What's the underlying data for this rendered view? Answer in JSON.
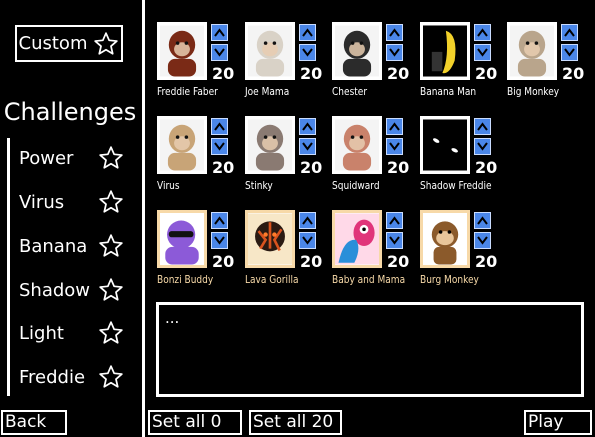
{
  "left_panel": {
    "custom_label": "Custom",
    "challenges_title": "Challenges",
    "challenges": [
      {
        "label": "Power"
      },
      {
        "label": "Virus"
      },
      {
        "label": "Banana"
      },
      {
        "label": "Shadow"
      },
      {
        "label": "Light"
      },
      {
        "label": "Freddie"
      }
    ],
    "back_label": "Back"
  },
  "characters": [
    {
      "name": "Freddie Faber",
      "level": "20",
      "highlight": false,
      "icon": "monkey-plush",
      "color": "#7a2a16"
    },
    {
      "name": "Joe Mama",
      "level": "20",
      "highlight": false,
      "icon": "mandrill",
      "color": "#d9d2c7"
    },
    {
      "name": "Chester",
      "level": "20",
      "highlight": false,
      "icon": "chimp-suit",
      "color": "#2b2b2b"
    },
    {
      "name": "Banana Man",
      "level": "20",
      "highlight": false,
      "icon": "banana-costume",
      "color": "#f2d12a"
    },
    {
      "name": "Big Monkey",
      "level": "20",
      "highlight": false,
      "icon": "macaque",
      "color": "#b9a58c"
    },
    {
      "name": "Virus",
      "level": "20",
      "highlight": false,
      "icon": "macaque-sitting",
      "color": "#c8a477"
    },
    {
      "name": "Stinky",
      "level": "20",
      "highlight": false,
      "icon": "ape-face",
      "color": "#8a7a72"
    },
    {
      "name": "Squidward",
      "level": "20",
      "highlight": false,
      "icon": "proboscis-monkey",
      "color": "#c9826b"
    },
    {
      "name": "Shadow Freddie",
      "level": "20",
      "highlight": false,
      "icon": "shadow-eyes",
      "color": "#000000"
    },
    {
      "name": "Bonzi Buddy",
      "level": "20",
      "highlight": true,
      "icon": "purple-gorilla",
      "color": "#8c5ad8"
    },
    {
      "name": "Lava Gorilla",
      "level": "20",
      "highlight": true,
      "icon": "lava-gorilla",
      "color": "#d9531e"
    },
    {
      "name": "Baby and Mama",
      "level": "20",
      "highlight": true,
      "icon": "blue-pink-creatures",
      "color": "#2a8fd9"
    },
    {
      "name": "Burg Monkey",
      "level": "20",
      "highlight": true,
      "icon": "cartoon-monkey",
      "color": "#8b5a2b"
    }
  ],
  "textbox": {
    "text": "..."
  },
  "bottom": {
    "set_all_0_label": "Set all 0",
    "set_all_20_label": "Set all 20",
    "play_label": "Play"
  }
}
